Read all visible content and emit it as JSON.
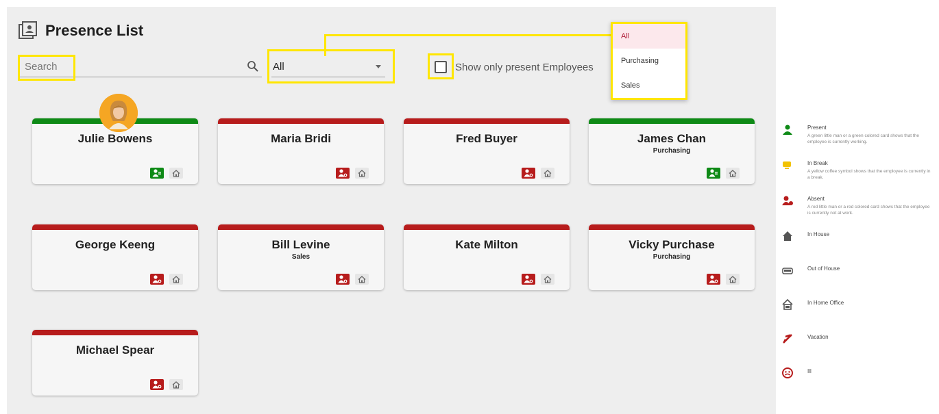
{
  "header": {
    "title": "Presence List",
    "title_icon": "contact-card-icon"
  },
  "search": {
    "placeholder": "Search",
    "value": "",
    "icon": "search-icon"
  },
  "filter": {
    "selected": "All",
    "options": [
      "All",
      "Purchasing",
      "Sales"
    ]
  },
  "present_filter": {
    "label": "Show only present Employees",
    "checked": false
  },
  "colors": {
    "present": "#0e8a16",
    "absent": "#b71c1c",
    "break": "#f2c200",
    "highlight": "#ffe600"
  },
  "employees": [
    {
      "name": "Julie Bowens",
      "department": "",
      "status": "present",
      "location": "in-house",
      "has_photo": true
    },
    {
      "name": "Maria Bridi",
      "department": "",
      "status": "absent",
      "location": "in-house"
    },
    {
      "name": "Fred Buyer",
      "department": "",
      "status": "absent",
      "location": "in-house"
    },
    {
      "name": "James Chan",
      "department": "Purchasing",
      "status": "present",
      "location": "in-house"
    },
    {
      "name": "George Keeng",
      "department": "",
      "status": "absent",
      "location": "in-house"
    },
    {
      "name": "Bill Levine",
      "department": "Sales",
      "status": "absent",
      "location": "in-house"
    },
    {
      "name": "Kate Milton",
      "department": "",
      "status": "absent",
      "location": "in-house"
    },
    {
      "name": "Vicky Purchase",
      "department": "Purchasing",
      "status": "absent",
      "location": "in-house"
    },
    {
      "name": "Michael Spear",
      "department": "",
      "status": "absent",
      "location": "in-house"
    }
  ],
  "legend": [
    {
      "icon": "present-person-icon",
      "title": "Present",
      "desc": "A green little man or a green colored card shows that the employee is currently working."
    },
    {
      "icon": "coffee-cup-icon",
      "title": "In Break",
      "desc": "A yellow coffee symbol shows that the employee is currently in a break."
    },
    {
      "icon": "absent-person-icon",
      "title": "Absent",
      "desc": "A red little man or a red colored card shows that the employee is currently not at work."
    },
    {
      "icon": "house-icon",
      "title": "In House",
      "desc": ""
    },
    {
      "icon": "car-icon",
      "title": "Out of House",
      "desc": ""
    },
    {
      "icon": "home-office-icon",
      "title": "In Home Office",
      "desc": ""
    },
    {
      "icon": "airplane-icon",
      "title": "Vacation",
      "desc": ""
    },
    {
      "icon": "sick-face-icon",
      "title": "Ill",
      "desc": ""
    }
  ]
}
